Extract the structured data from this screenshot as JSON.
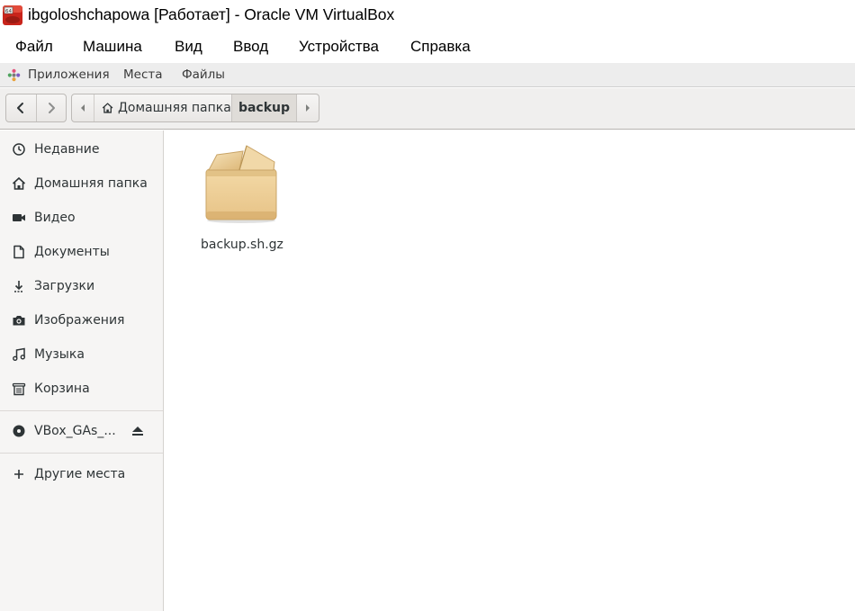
{
  "window": {
    "title": "ibgoloshchapowa [Работает] - Oracle VM VirtualBox",
    "app_icon": "virtualbox-icon"
  },
  "vbox_menu": {
    "items": [
      "Файл",
      "Машина",
      "Вид",
      "Ввод",
      "Устройства",
      "Справка"
    ]
  },
  "gnome_panel": {
    "applications": "Приложения",
    "places": "Места",
    "files": "Файлы"
  },
  "headerbar": {
    "back_icon": "chevron-left-icon",
    "forward_icon": "chevron-right-icon",
    "path": {
      "home_label": "Домашняя папка",
      "current_label": "backup"
    }
  },
  "sidebar": {
    "items": [
      {
        "label": "Недавние",
        "icon": "clock-icon"
      },
      {
        "label": "Домашняя папка",
        "icon": "home-icon"
      },
      {
        "label": "Видео",
        "icon": "video-icon"
      },
      {
        "label": "Документы",
        "icon": "document-icon"
      },
      {
        "label": "Загрузки",
        "icon": "download-icon"
      },
      {
        "label": "Изображения",
        "icon": "camera-icon"
      },
      {
        "label": "Музыка",
        "icon": "music-icon"
      },
      {
        "label": "Корзина",
        "icon": "trash-icon"
      }
    ],
    "device": {
      "label": "VBox_GAs_...",
      "icon": "disc-icon",
      "action_icon": "eject-icon"
    },
    "other": {
      "label": "Другие места",
      "icon": "plus-icon"
    }
  },
  "files": [
    {
      "name": "backup.sh.gz",
      "icon": "package-icon"
    }
  ],
  "colors": {
    "folder_tan": "#e9c68a",
    "sidebar_bg": "#f6f5f4",
    "headerbar_bg": "#f0efee"
  }
}
